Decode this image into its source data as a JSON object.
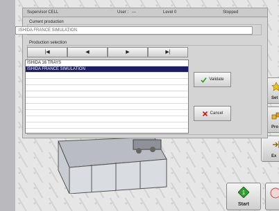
{
  "status": {
    "station": "Supervisor CELL",
    "user_label": "User :",
    "user_value": "---",
    "level": "Level 0",
    "state": "Stopped"
  },
  "dialog": {
    "current_production_title": "Current production",
    "current_production_value": "ISHIDA FRANCE SIMULATION",
    "production_selection_title": "Production selection",
    "nav": {
      "first": "|◀",
      "prev": "◀",
      "next": "▶",
      "last": "▶|"
    },
    "list": {
      "items": [
        "ISHIDA 16 TRAYS",
        "ISHIDA FRANCE SIMULATION"
      ],
      "selected_index": 1
    },
    "validate_label": "Validate",
    "cancel_label": "Cancel"
  },
  "side_buttons": {
    "setup_label": "Set",
    "production_label": "Pro",
    "exit_label": "Ex"
  },
  "bottom_buttons": {
    "start_label": "Start"
  },
  "colors": {
    "selection": "#1c1d62",
    "validate_check": "#2c9a2c",
    "cancel_x": "#cc1a1a",
    "start_green": "#2f9f2f"
  }
}
